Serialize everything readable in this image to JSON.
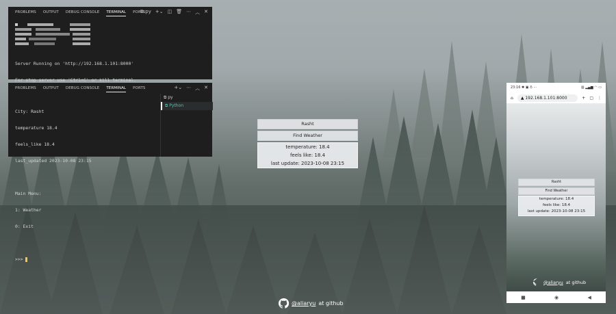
{
  "term1": {
    "tabs": [
      "PROBLEMS",
      "OUTPUT",
      "DEBUG CONSOLE",
      "TERMINAL",
      "PORTS"
    ],
    "active_tab": "TERMINAL",
    "shell_label": "py",
    "lines": [
      "Server Running on 'http://192.168.1.101:8000'",
      "For stop server use 'Ctrl+C' or kill terminal.",
      "..."
    ]
  },
  "term2": {
    "tabs": [
      "PROBLEMS",
      "OUTPUT",
      "DEBUG CONSOLE",
      "TERMINAL",
      "PORTS"
    ],
    "active_tab": "TERMINAL",
    "shells": [
      "py",
      "Python"
    ],
    "lines": [
      "City: Rasht",
      "temperature 18.4",
      "feels_like 18.4",
      "last_updated 2023-10-08 23:15",
      "",
      "Main Menu:",
      "1: Weather",
      "0: Exit",
      ""
    ],
    "prompt": ">>> "
  },
  "web": {
    "city_value": "Rasht",
    "find_button": "Find Weather",
    "temperature": "temperature: 18.4",
    "feels_like": "feels like: 18.4",
    "last_update": "last update: 2023-10-08 23:15",
    "footer_handle": "@aliaryu",
    "footer_suffix": "at github"
  },
  "phone": {
    "status_time": "23:16",
    "url": "192.168.1.101:8000",
    "city_value": "Rasht",
    "find_button": "Find Weather",
    "temperature": "temperature: 18.4",
    "feels_like": "feels like: 18.4",
    "last_update": "last update: 2023-10-08 23:15",
    "footer_handle": "@aliaryu",
    "footer_suffix": "at github"
  }
}
